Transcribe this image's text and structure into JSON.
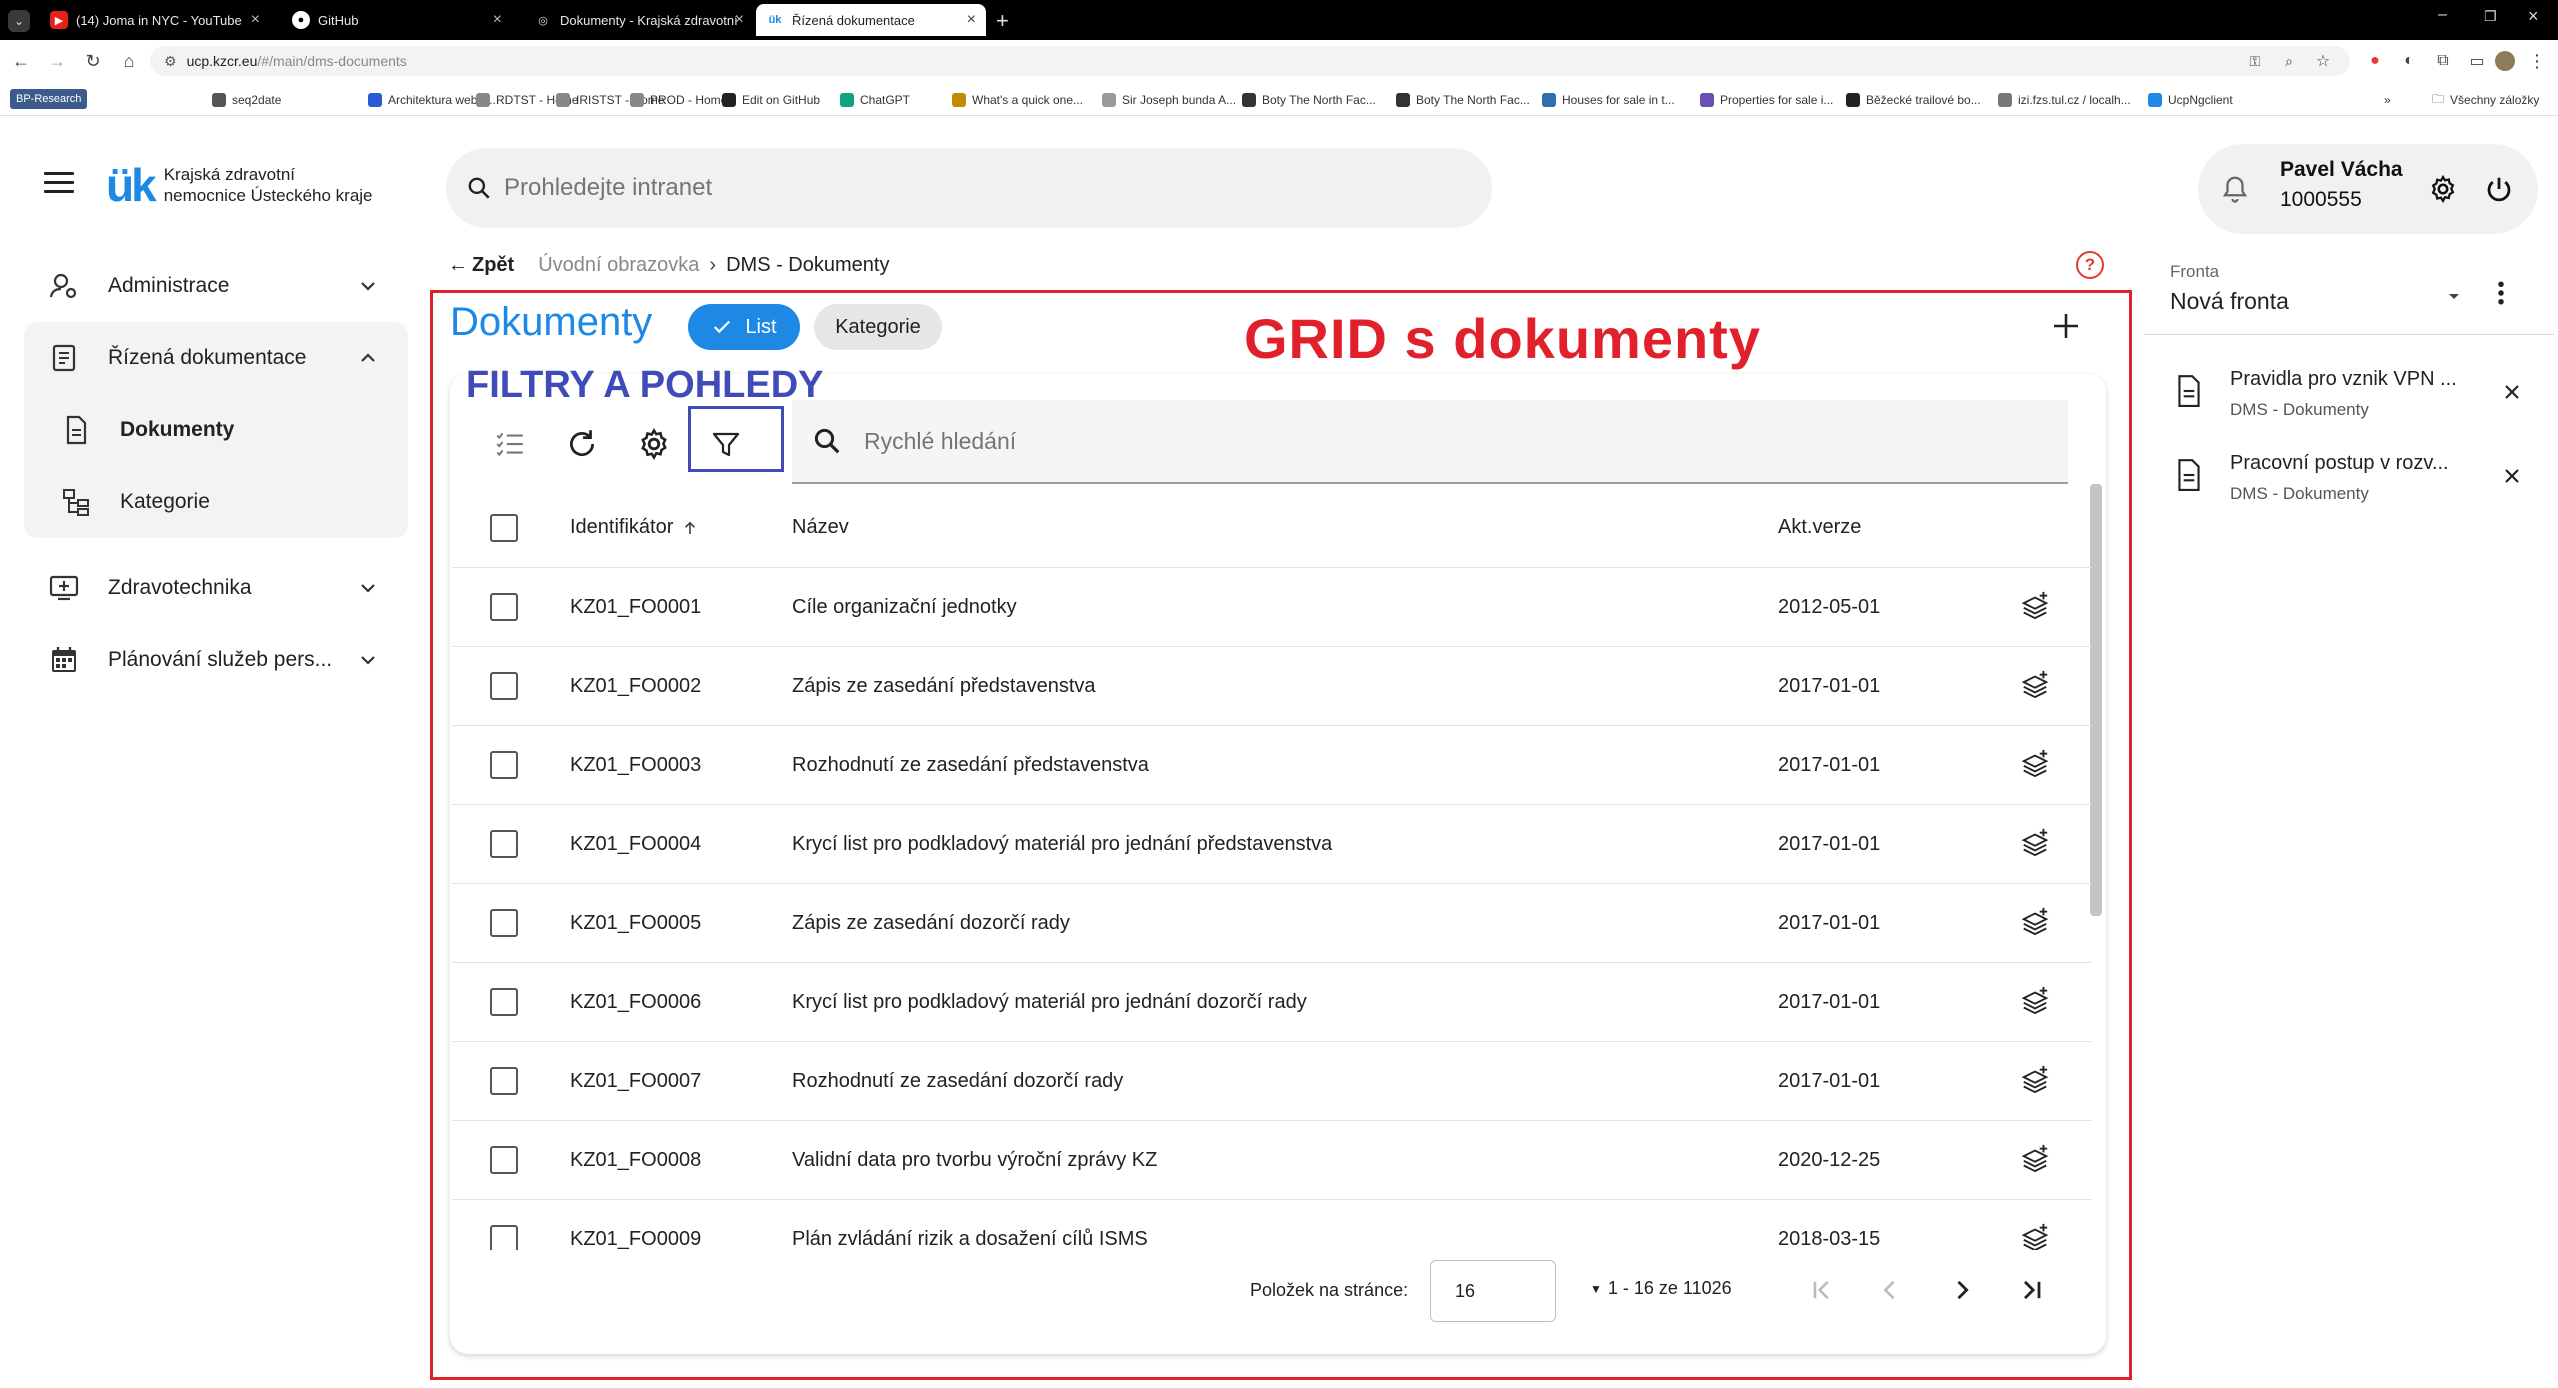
{
  "browser": {
    "tabs": [
      {
        "title": "(14) Joma in NYC - YouTube",
        "active": false
      },
      {
        "title": "GitHub",
        "active": false
      },
      {
        "title": "Dokumenty - Krajská zdravotní",
        "active": false
      },
      {
        "title": "Řízená dokumentace",
        "active": true
      }
    ],
    "url_host": "ucp.kzcr.eu",
    "url_path": "/#/main/dms-documents",
    "bookmarks": [
      "BP-Research",
      "seq2date",
      "Architektura webov...",
      "RDTST - Home",
      "IRISTST - Home",
      "PROD - Home",
      "Edit on GitHub",
      "ChatGPT",
      "What's a quick one...",
      "Sir Joseph bunda A...",
      "Boty The North Fac...",
      "Boty The North Fac...",
      "Houses for sale in t...",
      "Properties for sale i...",
      "Běžecké trailové bo...",
      "izi.fzs.tul.cz / localh...",
      "UcpNgclient"
    ],
    "all_bookmarks": "Všechny záložky"
  },
  "header": {
    "logo_mark": "ük",
    "logo_line1": "Krajská zdravotní",
    "logo_line2": "nemocnice Ústeckého kraje",
    "search_placeholder": "Prohledejte intranet",
    "user_name": "Pavel Vácha",
    "user_id": "1000555"
  },
  "sidebar": {
    "items": [
      {
        "label": "Administrace"
      },
      {
        "label": "Řízená dokumentace"
      },
      {
        "label": "Dokumenty"
      },
      {
        "label": "Kategorie"
      },
      {
        "label": "Zdravotechnika"
      },
      {
        "label": "Plánování služeb pers..."
      }
    ]
  },
  "breadcrumb": {
    "back": "Zpět",
    "home": "Úvodní obrazovka",
    "current": "DMS - Dokumenty"
  },
  "main": {
    "title": "Dokumenty",
    "chip_list": "List",
    "chip_category": "Kategorie",
    "quick_search_placeholder": "Rychlé hledání",
    "annotation_grid": "GRID s dokumenty",
    "annotation_filters": "FILTRY A POHLEDY",
    "annotation_color": "#e0212b",
    "filter_highlight_color": "#3f4bb8",
    "accent_color": "#1e88e5"
  },
  "table": {
    "columns": {
      "id": "Identifikátor",
      "name": "Název",
      "version": "Akt.verze"
    },
    "rows": [
      {
        "id": "KZ01_FO0001",
        "name": "Cíle organizační jednotky",
        "version": "2012-05-01"
      },
      {
        "id": "KZ01_FO0002",
        "name": "Zápis ze zasedání představenstva",
        "version": "2017-01-01"
      },
      {
        "id": "KZ01_FO0003",
        "name": "Rozhodnutí ze zasedání představenstva",
        "version": "2017-01-01"
      },
      {
        "id": "KZ01_FO0004",
        "name": "Krycí list pro podkladový materiál pro jednání představenstva",
        "version": "2017-01-01"
      },
      {
        "id": "KZ01_FO0005",
        "name": "Zápis ze zasedání dozorčí rady",
        "version": "2017-01-01"
      },
      {
        "id": "KZ01_FO0006",
        "name": "Krycí list pro podkladový materiál pro jednání dozorčí rady",
        "version": "2017-01-01"
      },
      {
        "id": "KZ01_FO0007",
        "name": "Rozhodnutí ze zasedání dozorčí rady",
        "version": "2017-01-01"
      },
      {
        "id": "KZ01_FO0008",
        "name": "Validní data pro tvorbu výroční zprávy KZ",
        "version": "2020-12-25"
      },
      {
        "id": "KZ01_FO0009",
        "name": "Plán zvládání rizik a dosažení cílů ISMS",
        "version": "2018-03-15"
      }
    ]
  },
  "pager": {
    "label": "Položek na stránce:",
    "page_size": "16",
    "range": "1 - 16 ze 11026"
  },
  "queue": {
    "label": "Fronta",
    "value": "Nová fronta",
    "items": [
      {
        "title": "Pravidla pro vznik VPN ...",
        "subtitle": "DMS - Dokumenty"
      },
      {
        "title": "Pracovní postup v rozv...",
        "subtitle": "DMS - Dokumenty"
      }
    ]
  }
}
